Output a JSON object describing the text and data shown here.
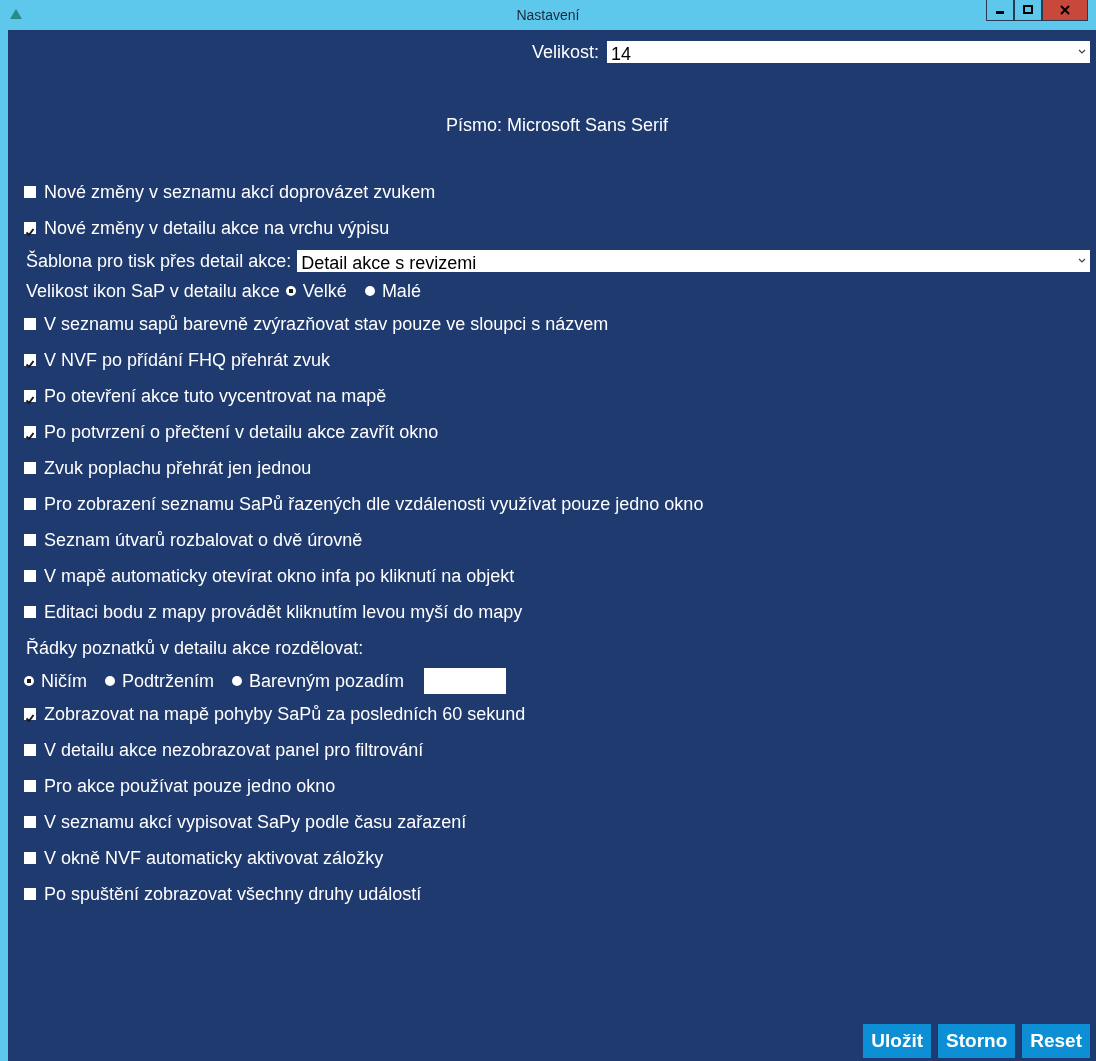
{
  "window": {
    "title": "Nastavení"
  },
  "size": {
    "label": "Velikost:",
    "value": "14"
  },
  "font": {
    "text": "Písmo: Microsoft Sans Serif"
  },
  "options": [
    {
      "kind": "checkbox",
      "label": "Nové změny v seznamu akcí doprovázet zvukem",
      "checked": false
    },
    {
      "kind": "checkbox",
      "label": "Nové změny v detailu akce na vrchu výpisu",
      "checked": true
    },
    {
      "kind": "select",
      "label": "Šablona pro tisk přes detail akce:",
      "value": "Detail akce s revizemi"
    },
    {
      "kind": "radio",
      "label": "Velikost ikon SaP v detailu akce",
      "choices": [
        {
          "label": "Velké",
          "selected": true
        },
        {
          "label": "Malé",
          "selected": false
        }
      ]
    },
    {
      "kind": "checkbox",
      "label": "V seznamu sapů barevně zvýrazňovat stav pouze ve sloupci s názvem",
      "checked": false
    },
    {
      "kind": "checkbox",
      "label": "V NVF po přídání FHQ přehrát zvuk",
      "checked": true
    },
    {
      "kind": "checkbox",
      "label": "Po otevření akce tuto vycentrovat na mapě",
      "checked": true
    },
    {
      "kind": "checkbox",
      "label": "Po potvrzení o přečtení v detailu akce zavřít okno",
      "checked": true
    },
    {
      "kind": "checkbox",
      "label": "Zvuk poplachu přehrát jen jednou",
      "checked": false
    },
    {
      "kind": "checkbox",
      "label": "Pro zobrazení seznamu SaPů řazených dle vzdálenosti využívat pouze jedno okno",
      "checked": false
    },
    {
      "kind": "checkbox",
      "label": "Seznam útvarů rozbalovat o dvě úrovně",
      "checked": false
    },
    {
      "kind": "checkbox",
      "label": "V mapě automaticky otevírat okno infa po kliknutí na objekt",
      "checked": false
    },
    {
      "kind": "checkbox",
      "label": "Editaci bodu z mapy provádět kliknutím levou myší do mapy",
      "checked": false
    },
    {
      "kind": "text",
      "label": "Řádky poznatků v detailu akce rozdělovat:"
    },
    {
      "kind": "radio",
      "choices": [
        {
          "label": "Ničím",
          "selected": true
        },
        {
          "label": "Podtržením",
          "selected": false
        },
        {
          "label": "Barevným pozadím",
          "selected": false
        }
      ],
      "swatch": true
    },
    {
      "kind": "checkbox",
      "label": "Zobrazovat na mapě pohyby SaPů za posledních 60 sekund",
      "checked": true
    },
    {
      "kind": "checkbox",
      "label": "V detailu akce nezobrazovat panel pro filtrování",
      "checked": false
    },
    {
      "kind": "checkbox",
      "label": "Pro akce používat pouze jedno okno",
      "checked": false
    },
    {
      "kind": "checkbox",
      "label": "V seznamu akcí vypisovat SaPy podle času zařazení",
      "checked": false
    },
    {
      "kind": "checkbox",
      "label": "V okně NVF automaticky aktivovat záložky",
      "checked": false
    },
    {
      "kind": "checkbox",
      "label": "Po spuštění zobrazovat všechny druhy událostí",
      "checked": false
    }
  ],
  "buttons": [
    "Uložit",
    "Storno",
    "Reset"
  ]
}
